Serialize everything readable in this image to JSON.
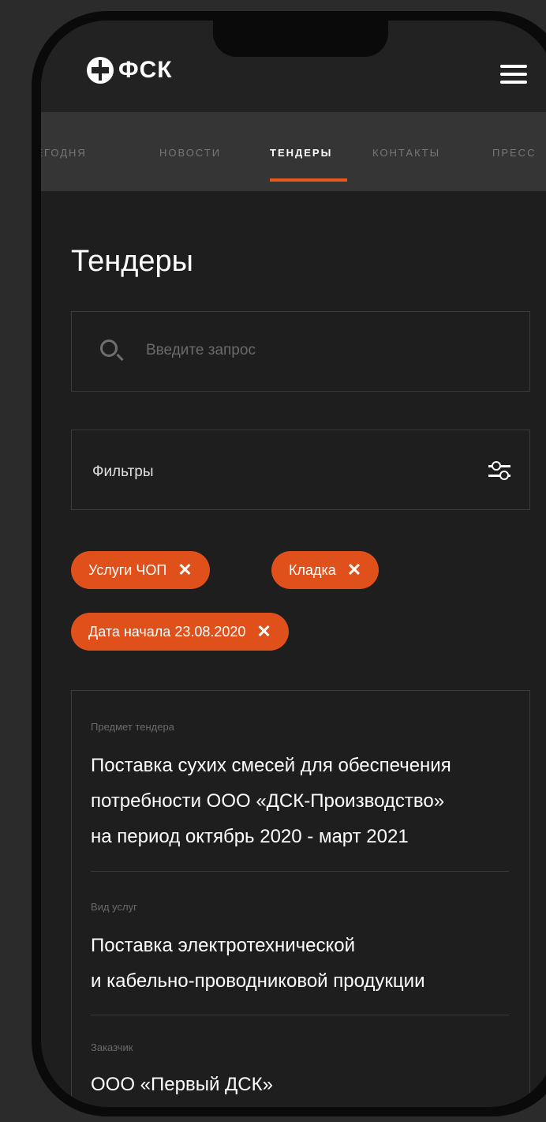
{
  "header": {
    "logo_text": "ФСК",
    "menu_icon": "hamburger-menu-icon"
  },
  "nav": {
    "tabs": [
      "Сегодня",
      "Новости",
      "Тендеры",
      "Контакты",
      "Пресс"
    ],
    "active_tab": "Тендеры"
  },
  "page": {
    "title": "Тендеры"
  },
  "search": {
    "placeholder": "Введите запрос"
  },
  "filters": {
    "label": "Фильтры",
    "icon": "sliders-icon"
  },
  "chips": [
    {
      "label": "Услуги ЧОП",
      "remove": "✕"
    },
    {
      "label": "Кладка",
      "remove": "✕"
    },
    {
      "label": "Дата начала 23.08.2020",
      "remove": "✕"
    }
  ],
  "tender": {
    "subject_label": "Предмет тендера",
    "subject_lines": [
      "Поставка сухих смесей для обеспечения",
      "потребности ООО «ДСК-Производство»",
      "на период октябрь 2020 - март 2021"
    ],
    "service_label": "Вид услуг",
    "service_lines": [
      "Поставка электротехнической",
      "и кабельно-проводниковой продукции"
    ],
    "customer_label": "Заказчик",
    "customer_value": "ООО «Первый ДСК»"
  },
  "colors": {
    "accent": "#e0501b",
    "background": "#1e1e1e",
    "nav_background": "#353535"
  }
}
